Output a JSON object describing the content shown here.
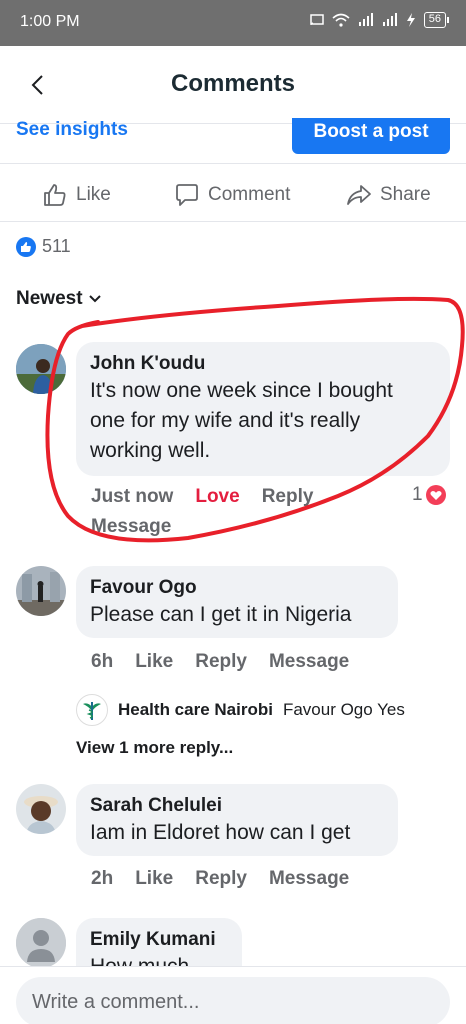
{
  "status_bar": {
    "time": "1:00 PM",
    "battery": "56"
  },
  "header": {
    "title": "Comments"
  },
  "post_bar": {
    "see_insights": "See insights",
    "boost": "Boost a post"
  },
  "actions": {
    "like": "Like",
    "comment": "Comment",
    "share": "Share"
  },
  "reactions": {
    "count": "511"
  },
  "sort": {
    "label": "Newest"
  },
  "comments": [
    {
      "name": "John K'oudu",
      "lines": [
        "It's now one week since I bought",
        "one for my wife and it's really",
        "working well."
      ],
      "time": "Just now",
      "love": "Love",
      "reply": "Reply",
      "message": "Message",
      "reaction_count": "1"
    },
    {
      "name": "Favour Ogo",
      "text": "Please can I get it in Nigeria",
      "time": "6h",
      "like": "Like",
      "reply": "Reply",
      "message": "Message"
    },
    {
      "name": "Sarah Chelulei",
      "text": "Iam in Eldoret how can I get",
      "time": "2h",
      "like": "Like",
      "reply": "Reply",
      "message": "Message"
    },
    {
      "name": "Emily Kumani",
      "text": "How much"
    }
  ],
  "reply_preview": {
    "name": "Health care Nairobi",
    "text": "Favour Ogo Yes",
    "view_more": "View 1 more reply..."
  },
  "composer": {
    "placeholder": "Write a comment..."
  },
  "colors": {
    "accent": "#1877f2",
    "love": "#e41e3f",
    "highlight": "#e8202a"
  }
}
